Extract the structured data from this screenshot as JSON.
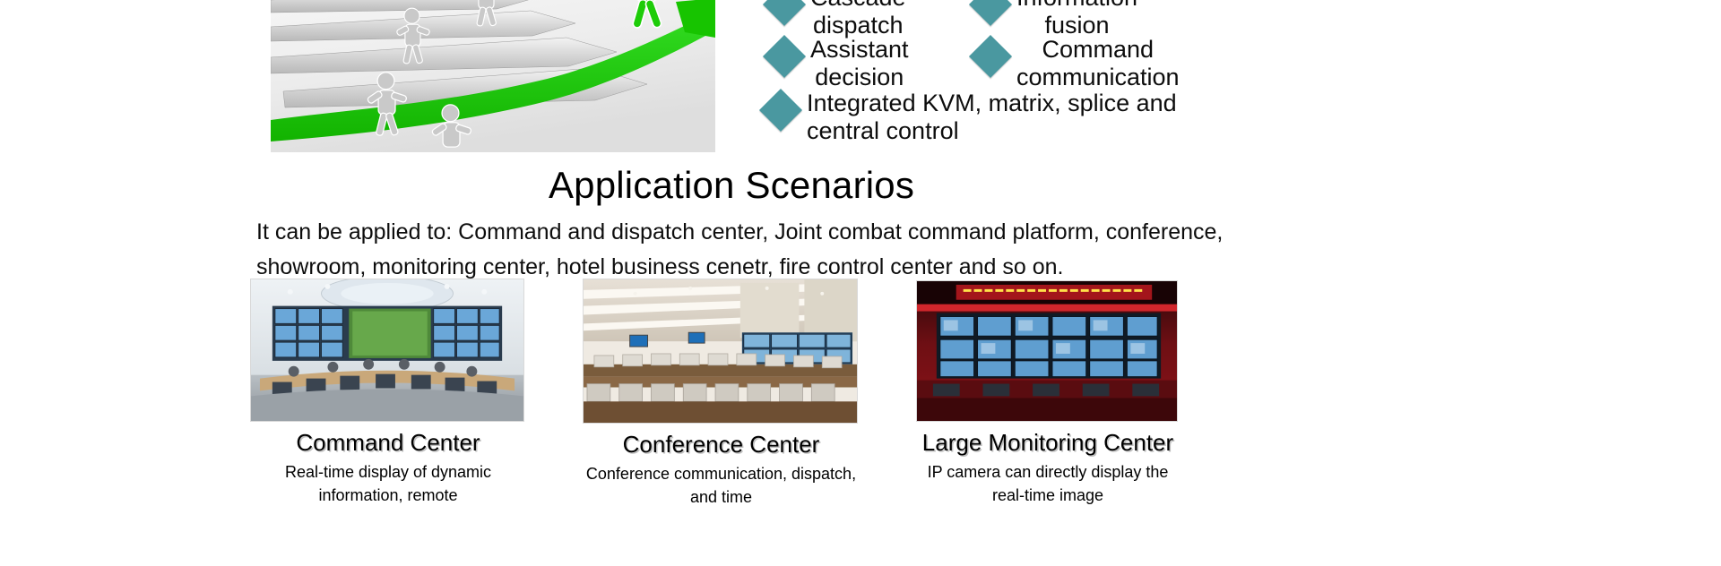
{
  "hero": {
    "alt": "green-arrow-leader-figures-image"
  },
  "features": {
    "items": [
      {
        "id": "cascade-dispatch",
        "label": "Cascade\ndispatch"
      },
      {
        "id": "assistant-decision",
        "label": "Assistant\ndecision"
      },
      {
        "id": "information-fusion",
        "label": "Information\nfusion"
      },
      {
        "id": "command-communication",
        "label": "Command\ncommunication"
      },
      {
        "id": "integrated-kvm",
        "label": "Integrated KVM, matrix, splice and\ncentral control"
      }
    ],
    "bullet_color": "#4a98a0"
  },
  "section": {
    "heading": "Application Scenarios",
    "intro": "It can be applied to: Command and dispatch center, Joint combat command platform, conference, showroom, monitoring center, hotel business cenetr, fire control center and so on."
  },
  "scenarios": [
    {
      "id": "command-center",
      "caption": "Command Center",
      "description": "Real-time display of dynamic information, remote"
    },
    {
      "id": "conference-center",
      "caption": "Conference Center",
      "description": "Conference communication, dispatch, and time"
    },
    {
      "id": "large-monitoring-center",
      "caption": "Large Monitoring Center",
      "description": "IP camera can directly display the real-time image"
    }
  ]
}
